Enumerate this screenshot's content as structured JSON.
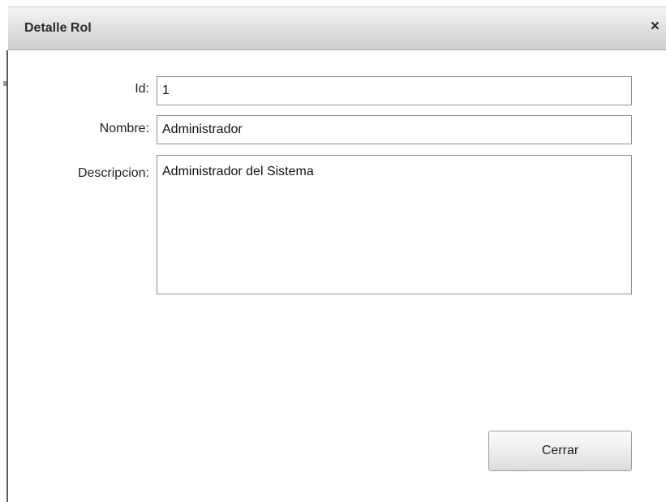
{
  "dialog": {
    "title": "Detalle Rol",
    "close_glyph": "×"
  },
  "form": {
    "id_label": "Id:",
    "id_value": "1",
    "nombre_label": "Nombre:",
    "nombre_value": "Administrador",
    "descripcion_label": "Descripcion:",
    "descripcion_value": "Administrador del Sistema"
  },
  "footer": {
    "close_button_label": "Cerrar"
  },
  "icons": {
    "close": "close-icon"
  }
}
